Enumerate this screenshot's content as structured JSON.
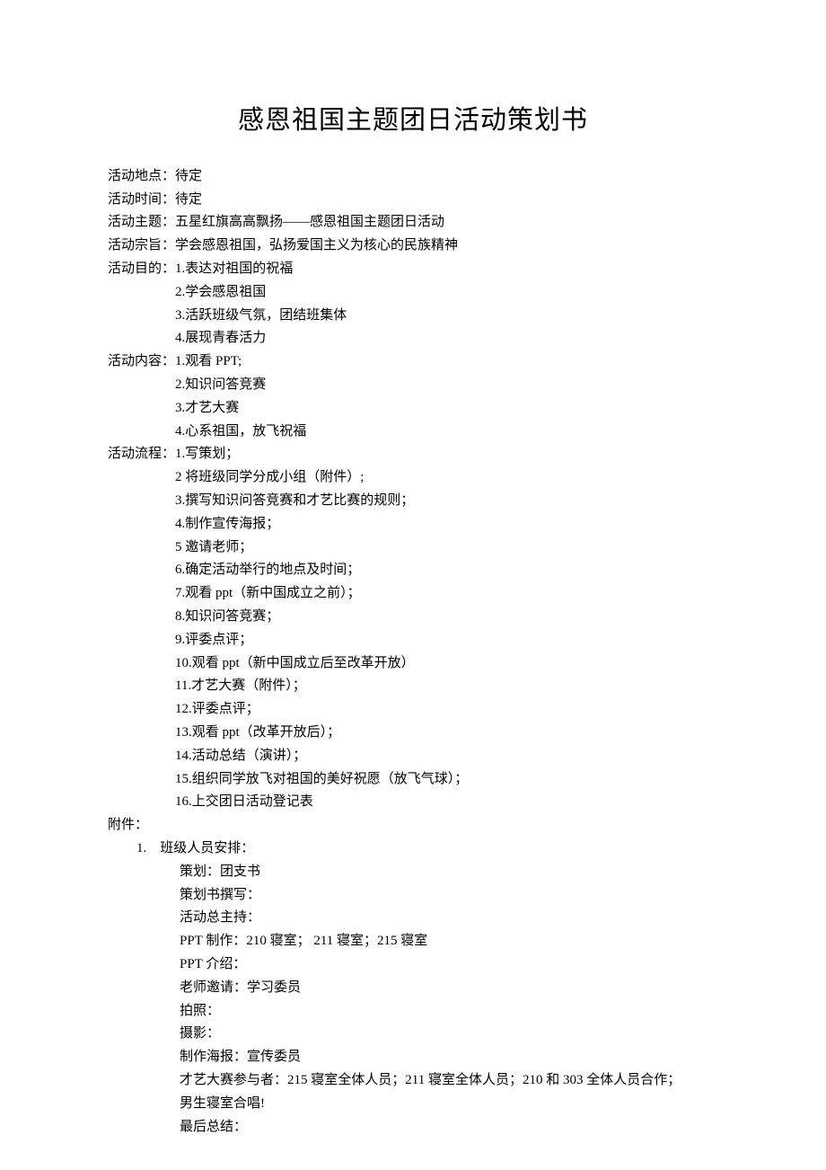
{
  "title": "感恩祖国主题团日活动策划书",
  "fields": {
    "location_label": "活动地点：",
    "location_value": "待定",
    "time_label": "活动时间：",
    "time_value": "待定",
    "theme_label": "活动主题：",
    "theme_value": "五星红旗高高飘扬——感恩祖国主题团日活动",
    "purpose_label": "活动宗旨：",
    "purpose_value": "学会感恩祖国，弘扬爱国主义为核心的民族精神",
    "goal_label": "活动目的：",
    "goal_1": "1.表达对祖国的祝福",
    "goal_2": "2.学会感恩祖国",
    "goal_3": "3.活跃班级气氛，团结班集体",
    "goal_4": "4.展现青春活力",
    "content_label": "活动内容：",
    "content_1": "1.观看 PPT;",
    "content_2": "2.知识问答竞赛",
    "content_3": "3.才艺大赛",
    "content_4": "4.心系祖国，放飞祝福",
    "flow_label": "活动流程：",
    "flow_1": "1.写策划；",
    "flow_2": "2 将班级同学分成小组（附件）;",
    "flow_3": "3.撰写知识问答竞赛和才艺比赛的规则；",
    "flow_4": "4.制作宣传海报；",
    "flow_5": "5 邀请老师；",
    "flow_6": "6.确定活动举行的地点及时间；",
    "flow_7": "7.观看 ppt（新中国成立之前）；",
    "flow_8": "8.知识问答竞赛；",
    "flow_9": "9.评委点评；",
    "flow_10": "10.观看 ppt（新中国成立后至改革开放）",
    "flow_11": "11.才艺大赛（附件）；",
    "flow_12": "12.评委点评；",
    "flow_13": "13.观看 ppt（改革开放后）；",
    "flow_14": "14.活动总结（演讲）；",
    "flow_15": "15.组织同学放飞对祖国的美好祝愿（放飞气球）；",
    "flow_16": "16.上交团日活动登记表"
  },
  "appendix": {
    "label": "附件：",
    "num_1": "1.　班级人员安排：",
    "a1": "策划：团支书",
    "a2": "策划书撰写：",
    "a3": "活动总主持：",
    "a4": "PPT 制作：210 寝室；  211 寝室；215 寝室",
    "a5": "PPT 介绍：",
    "a6": "老师邀请：学习委员",
    "a7": "拍照：",
    "a8": "摄影：",
    "a9": "制作海报：宣传委员",
    "a10": "才艺大赛参与者：215 寝室全体人员；211 寝室全体人员；210 和 303 全体人员合作；",
    "a11": "男生寝室合唱!",
    "a12": "最后总结："
  }
}
